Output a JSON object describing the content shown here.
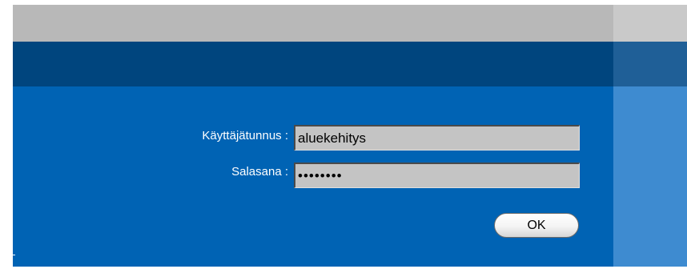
{
  "login": {
    "username_label": "Käyttäjätunnus :",
    "username_value": "aluekehitys",
    "password_label": "Salasana :",
    "password_value": "••••••••",
    "ok_label": "OK"
  }
}
